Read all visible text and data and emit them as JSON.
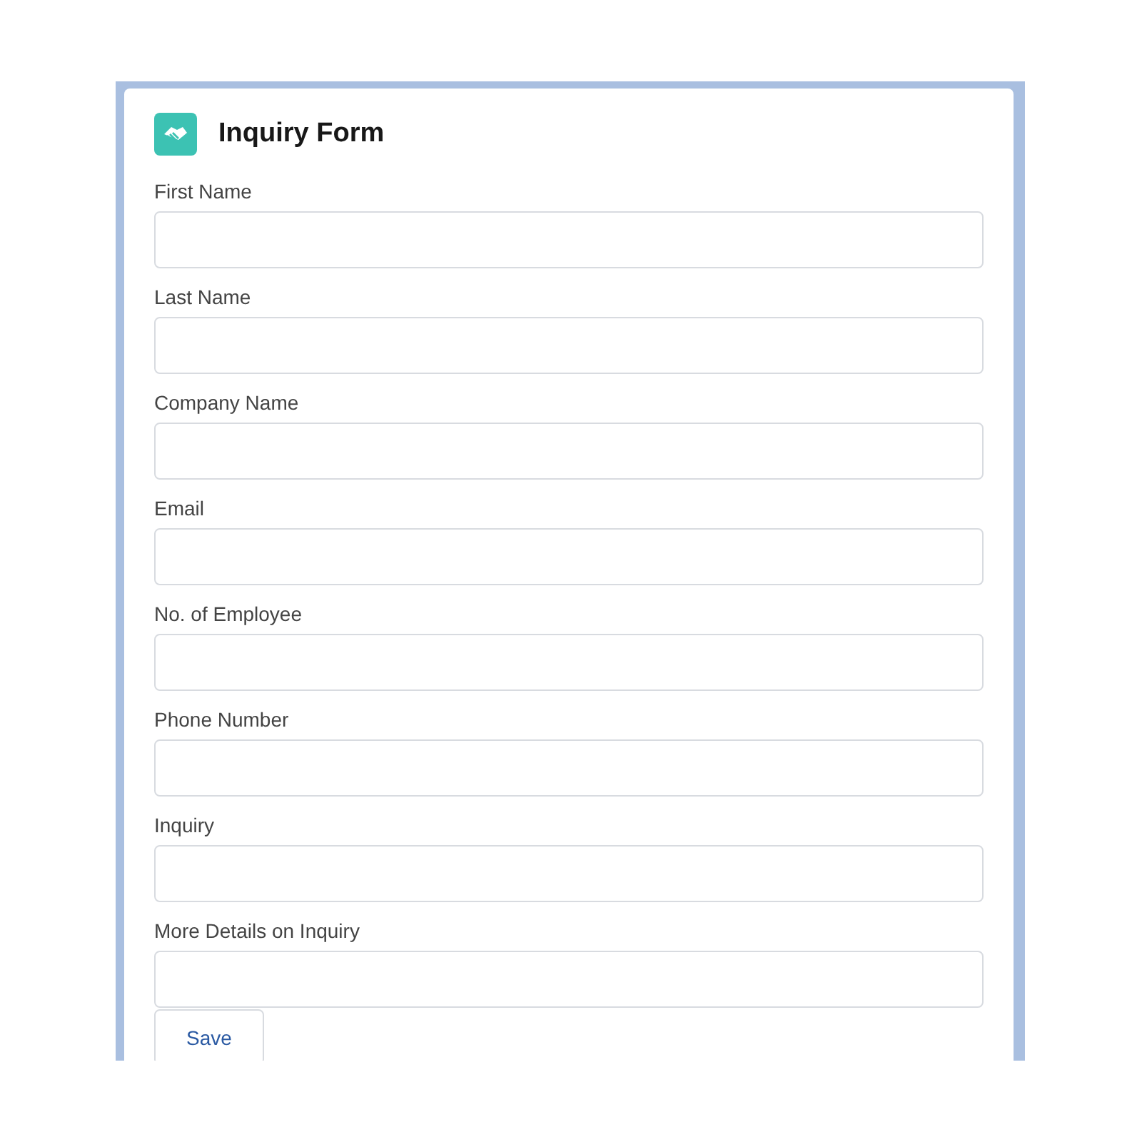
{
  "card": {
    "title": "Inquiry Form"
  },
  "fields": [
    {
      "label": "First Name"
    },
    {
      "label": "Last Name"
    },
    {
      "label": "Company Name"
    },
    {
      "label": "Email"
    },
    {
      "label": "No. of Employee"
    },
    {
      "label": "Phone Number"
    },
    {
      "label": "Inquiry"
    },
    {
      "label": "More Details on Inquiry"
    }
  ],
  "buttons": [
    "Save"
  ]
}
